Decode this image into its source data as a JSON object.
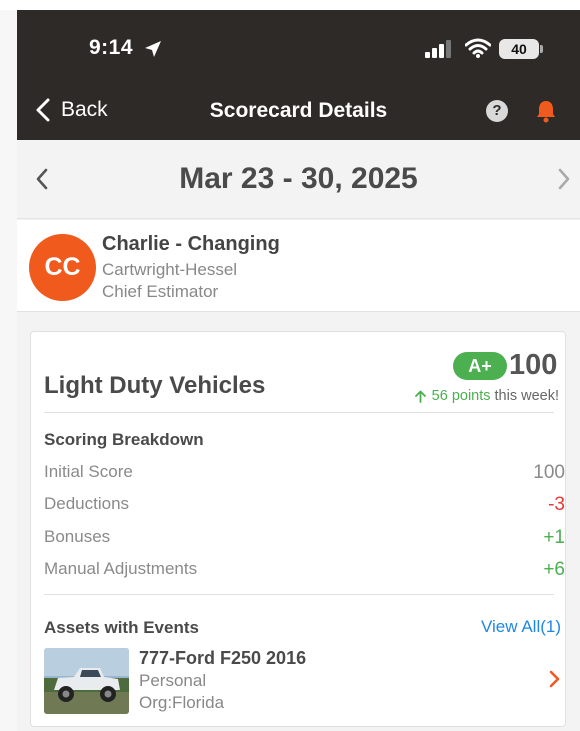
{
  "status_bar": {
    "time": "9:14",
    "battery": "40"
  },
  "nav": {
    "back_label": "Back",
    "title": "Scorecard Details",
    "help_symbol": "?"
  },
  "date_range": "Mar 23 - 30, 2025",
  "profile": {
    "initials": "CC",
    "name": "Charlie - Changing",
    "company": "Cartwright-Hessel",
    "role": "Chief Estimator"
  },
  "card": {
    "title": "Light Duty Vehicles",
    "grade": "A+",
    "score": "100",
    "week_points": "56 points",
    "week_suffix": "this week!",
    "breakdown_title": "Scoring Breakdown",
    "rows": [
      {
        "label": "Initial Score",
        "value": "100"
      },
      {
        "label": "Deductions",
        "value": "-3"
      },
      {
        "label": "Bonuses",
        "value": "+1"
      },
      {
        "label": "Manual Adjustments",
        "value": "+6"
      }
    ],
    "assets_title": "Assets with Events",
    "view_all": "View All(1)",
    "asset": {
      "name": "777-Ford F250 2016",
      "type": "Personal",
      "org": "Org:Florida"
    }
  },
  "colors": {
    "header_bg": "#2e2a27",
    "accent_orange": "#f15a1d",
    "positive_green": "#4caf50",
    "negative_red": "#e53935",
    "link_blue": "#1e88e5"
  },
  "icons": [
    "location-arrow-icon",
    "signal-icon",
    "wifi-icon",
    "battery-icon",
    "back-chevron-icon",
    "help-icon",
    "bell-icon",
    "chevron-left-icon",
    "chevron-right-icon",
    "up-arrow-icon",
    "truck-photo"
  ]
}
